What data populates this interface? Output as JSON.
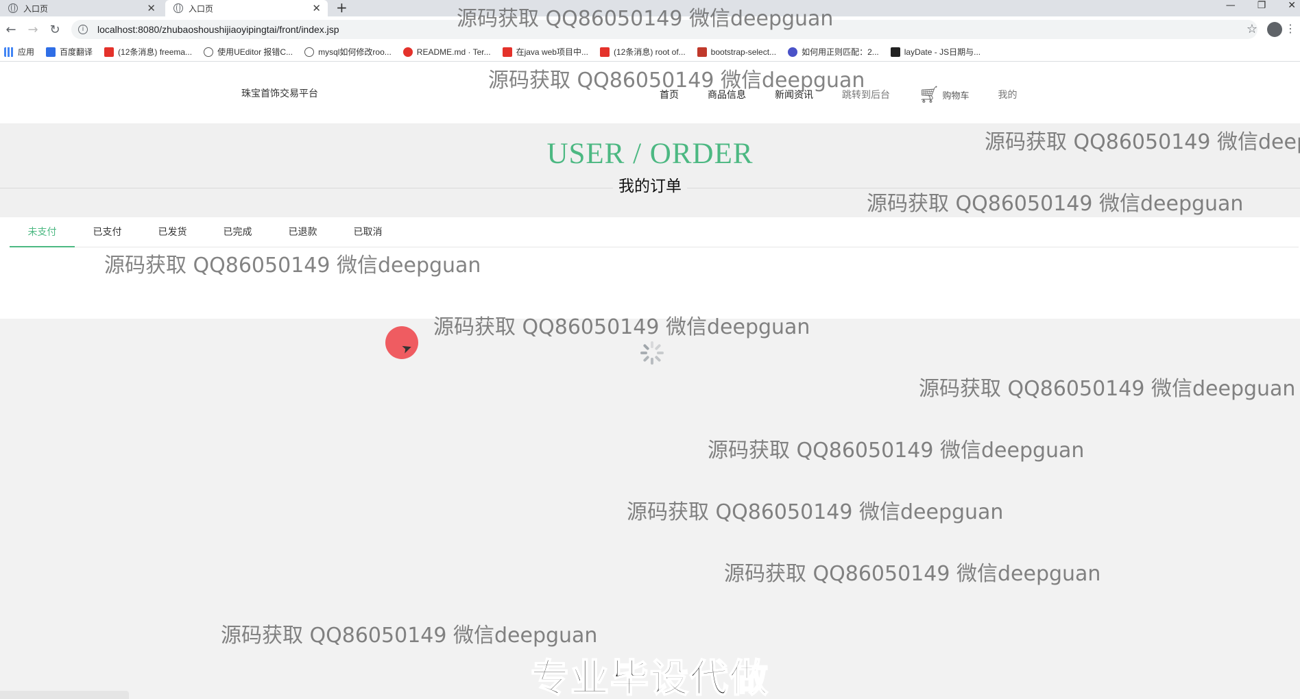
{
  "browser": {
    "tabs": [
      {
        "title": "入口页",
        "active": false
      },
      {
        "title": "入口页",
        "active": true
      }
    ],
    "new_tab": "+",
    "url": "localhost:8080/zhubaoshoushijiaoyipingtai/front/index.jsp",
    "bookmarks": [
      {
        "label": "应用",
        "icon": "apps-icon"
      },
      {
        "label": "百度翻译",
        "icon": "translate-icon"
      },
      {
        "label": "(12条消息) freema...",
        "icon": "csdn-icon"
      },
      {
        "label": "使用UEditor 报错C...",
        "icon": "link-icon"
      },
      {
        "label": "mysql如何修改roo...",
        "icon": "link-icon"
      },
      {
        "label": "README.md · Ter...",
        "icon": "gitee-icon"
      },
      {
        "label": "在java web项目中...",
        "icon": "csdn-icon"
      },
      {
        "label": "(12条消息) root of...",
        "icon": "csdn-icon"
      },
      {
        "label": "bootstrap-select...",
        "icon": "jianshu-icon"
      },
      {
        "label": "如何用正则匹配：2...",
        "icon": "baidu-icon"
      },
      {
        "label": "layDate - JS日期与...",
        "icon": "layui-icon"
      }
    ]
  },
  "header": {
    "brand": "珠宝首饰交易平台",
    "nav": [
      "首页",
      "商品信息",
      "新闻资讯",
      "跳转到后台"
    ],
    "cart_label": "购物车",
    "mine_label": "我的"
  },
  "banner": {
    "title_en": "USER / ORDER",
    "title_cn": "我的订单"
  },
  "order_tabs": [
    {
      "label": "未支付",
      "active": true
    },
    {
      "label": "已支付",
      "active": false
    },
    {
      "label": "已发货",
      "active": false
    },
    {
      "label": "已完成",
      "active": false
    },
    {
      "label": "已退款",
      "active": false
    },
    {
      "label": "已取消",
      "active": false
    }
  ],
  "watermark": "源码获取 QQ86050149 微信deepguan",
  "watermark_cut": "源码获取 QQ86050149 微信deep",
  "bottom_banner": "专业毕设代做",
  "colors": {
    "accent": "#4cb882",
    "cursor": "#ee4248"
  }
}
